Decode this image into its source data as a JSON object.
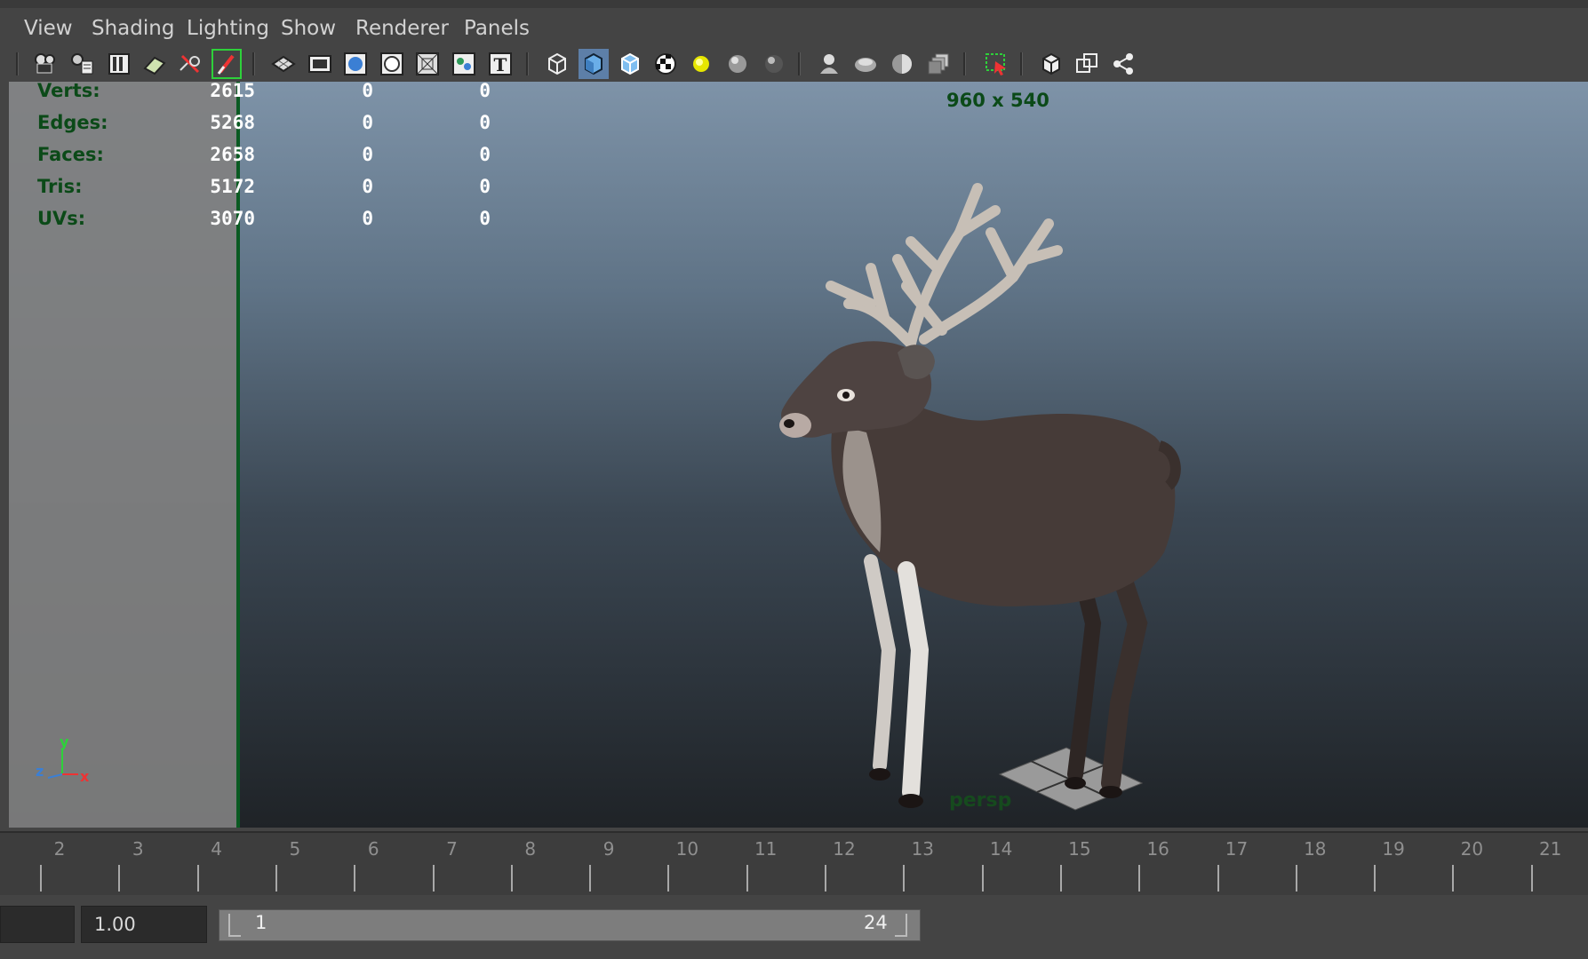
{
  "menu": {
    "items": [
      "View",
      "Shading",
      "Lighting",
      "Show",
      "Renderer",
      "Panels"
    ]
  },
  "toolbar": {
    "icons": [
      "camera-select-icon",
      "camera-attributes-icon",
      "bookmarks-icon",
      "image-plane-icon",
      "2d-pan-zoom-icon",
      "grease-pencil-icon",
      "grid-icon",
      "film-gate-icon",
      "resolution-gate-icon",
      "gate-mask-icon",
      "field-chart-icon",
      "safe-action-icon",
      "safe-title-icon",
      "wireframe-icon",
      "smooth-shade-icon",
      "wireframe-on-shaded-icon",
      "textured-icon",
      "use-all-lights-icon",
      "shadows-icon",
      "screen-space-ao-icon",
      "motion-blur-icon",
      "multisample-aa-icon",
      "depth-of-field-icon",
      "isolate-select-icon",
      "xray-icon",
      "xray-joints-icon",
      "xray-components-icon"
    ]
  },
  "hud": {
    "rows": [
      {
        "label": "Verts:",
        "c1": "2615",
        "c2": "0",
        "c3": "0"
      },
      {
        "label": "Edges:",
        "c1": "5268",
        "c2": "0",
        "c3": "0"
      },
      {
        "label": "Faces:",
        "c1": "2658",
        "c2": "0",
        "c3": "0"
      },
      {
        "label": "Tris:",
        "c1": "5172",
        "c2": "0",
        "c3": "0"
      },
      {
        "label": "UVs:",
        "c1": "3070",
        "c2": "0",
        "c3": "0"
      }
    ],
    "resolution": "960 x 540",
    "camera": "persp"
  },
  "axis": {
    "x": "x",
    "y": "y",
    "z": "z"
  },
  "timeslider": {
    "ticks": [
      "2",
      "3",
      "4",
      "5",
      "6",
      "7",
      "8",
      "9",
      "10",
      "11",
      "12",
      "13",
      "14",
      "15",
      "16",
      "17",
      "18",
      "19",
      "20",
      "21"
    ]
  },
  "range": {
    "playback_speed": "1.00",
    "start": "1",
    "end": "24"
  },
  "colors": {
    "hud_label": "#0b4a18",
    "hud_value": "#ffffff",
    "viewport_top": "#7e93a8",
    "viewport_bottom": "#1f2327"
  }
}
